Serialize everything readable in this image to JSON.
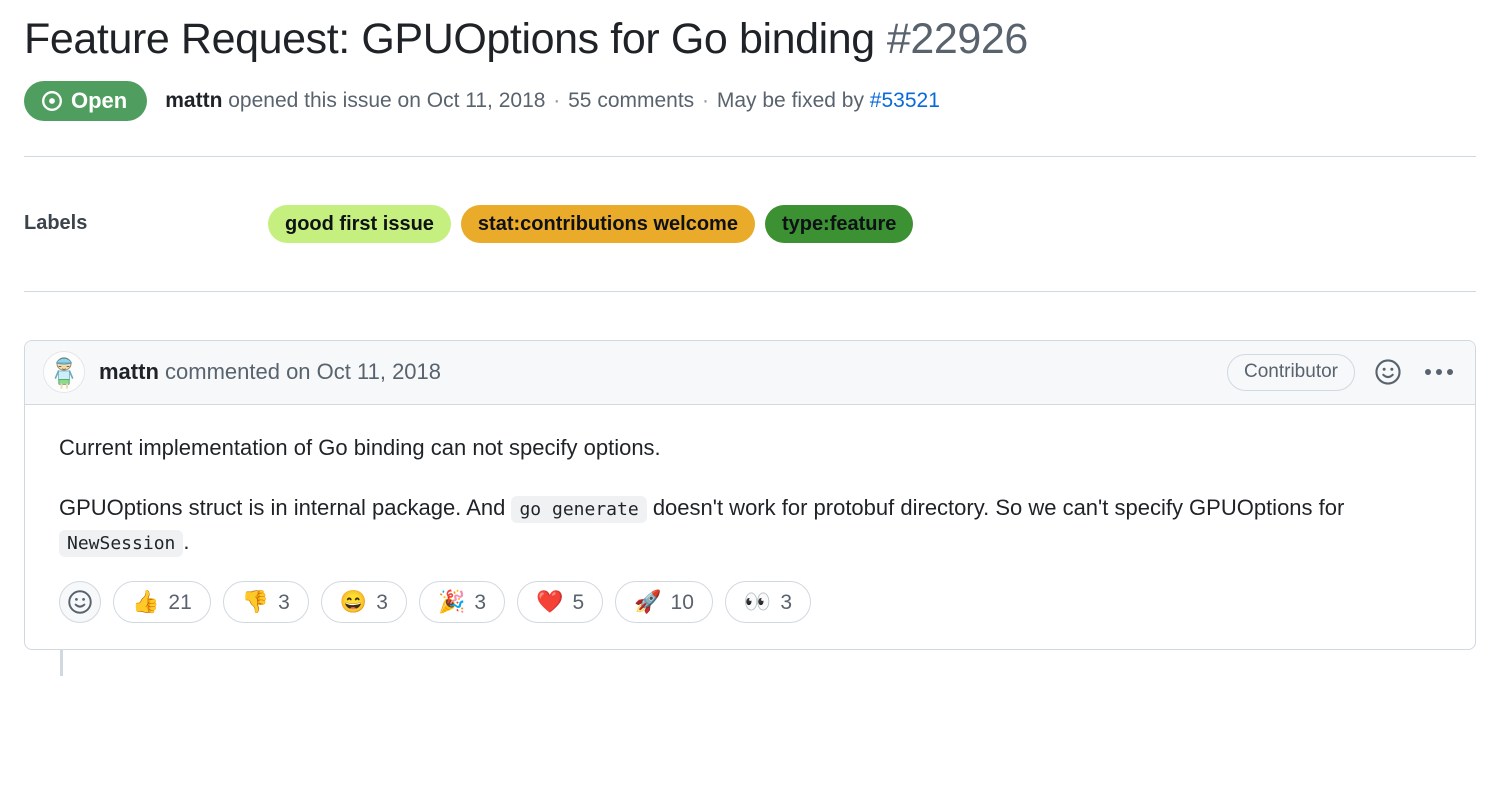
{
  "issue": {
    "title": "Feature Request: GPUOptions for Go binding",
    "number": "#22926",
    "state_label": "Open",
    "state_color": "#4f9e5f",
    "meta": {
      "author": "mattn",
      "opened_text": "opened this issue on",
      "opened_date": "Oct 11, 2018",
      "sep1": "·",
      "comments_text": "55 comments",
      "sep2": "·",
      "fixed_by_text": "May be fixed by",
      "fixed_by_link": "#53521",
      "link_color": "#0969da"
    }
  },
  "labels": {
    "heading": "Labels",
    "items": [
      {
        "name": "good first issue",
        "bg": "#c5ef7f",
        "fg": "#0e1116"
      },
      {
        "name": "stat:contributions welcome",
        "bg": "#eaaa2a",
        "fg": "#0e1116"
      },
      {
        "name": "type:feature",
        "bg": "#3c9133",
        "fg": "#0e1116"
      }
    ]
  },
  "comment": {
    "author": "mattn",
    "commented_text": "commented on",
    "date": "Oct 11, 2018",
    "association_badge": "Contributor",
    "avatar_icon": "user-avatar-cartoon",
    "reaction_icon": "smiley-icon",
    "menu_icon": "kebab-horizontal-icon",
    "body": {
      "p1": "Current implementation of Go binding can not specify options.",
      "p2_a": "GPUOptions struct is in internal package. And",
      "p2_code": "go generate",
      "p2_b": "doesn't work for protobuf directory. So we can't specify GPUOptions for",
      "p2_code2": "NewSession",
      "p2_c": "."
    },
    "reactions": {
      "add_label": "add-reaction",
      "items": [
        {
          "emoji": "👍",
          "name": "thumbs-up",
          "count": "21"
        },
        {
          "emoji": "👎",
          "name": "thumbs-down",
          "count": "3"
        },
        {
          "emoji": "😄",
          "name": "laugh",
          "count": "3"
        },
        {
          "emoji": "🎉",
          "name": "hooray",
          "count": "3"
        },
        {
          "emoji": "❤️",
          "name": "heart",
          "count": "5"
        },
        {
          "emoji": "🚀",
          "name": "rocket",
          "count": "10"
        },
        {
          "emoji": "👀",
          "name": "eyes",
          "count": "3"
        }
      ]
    }
  }
}
